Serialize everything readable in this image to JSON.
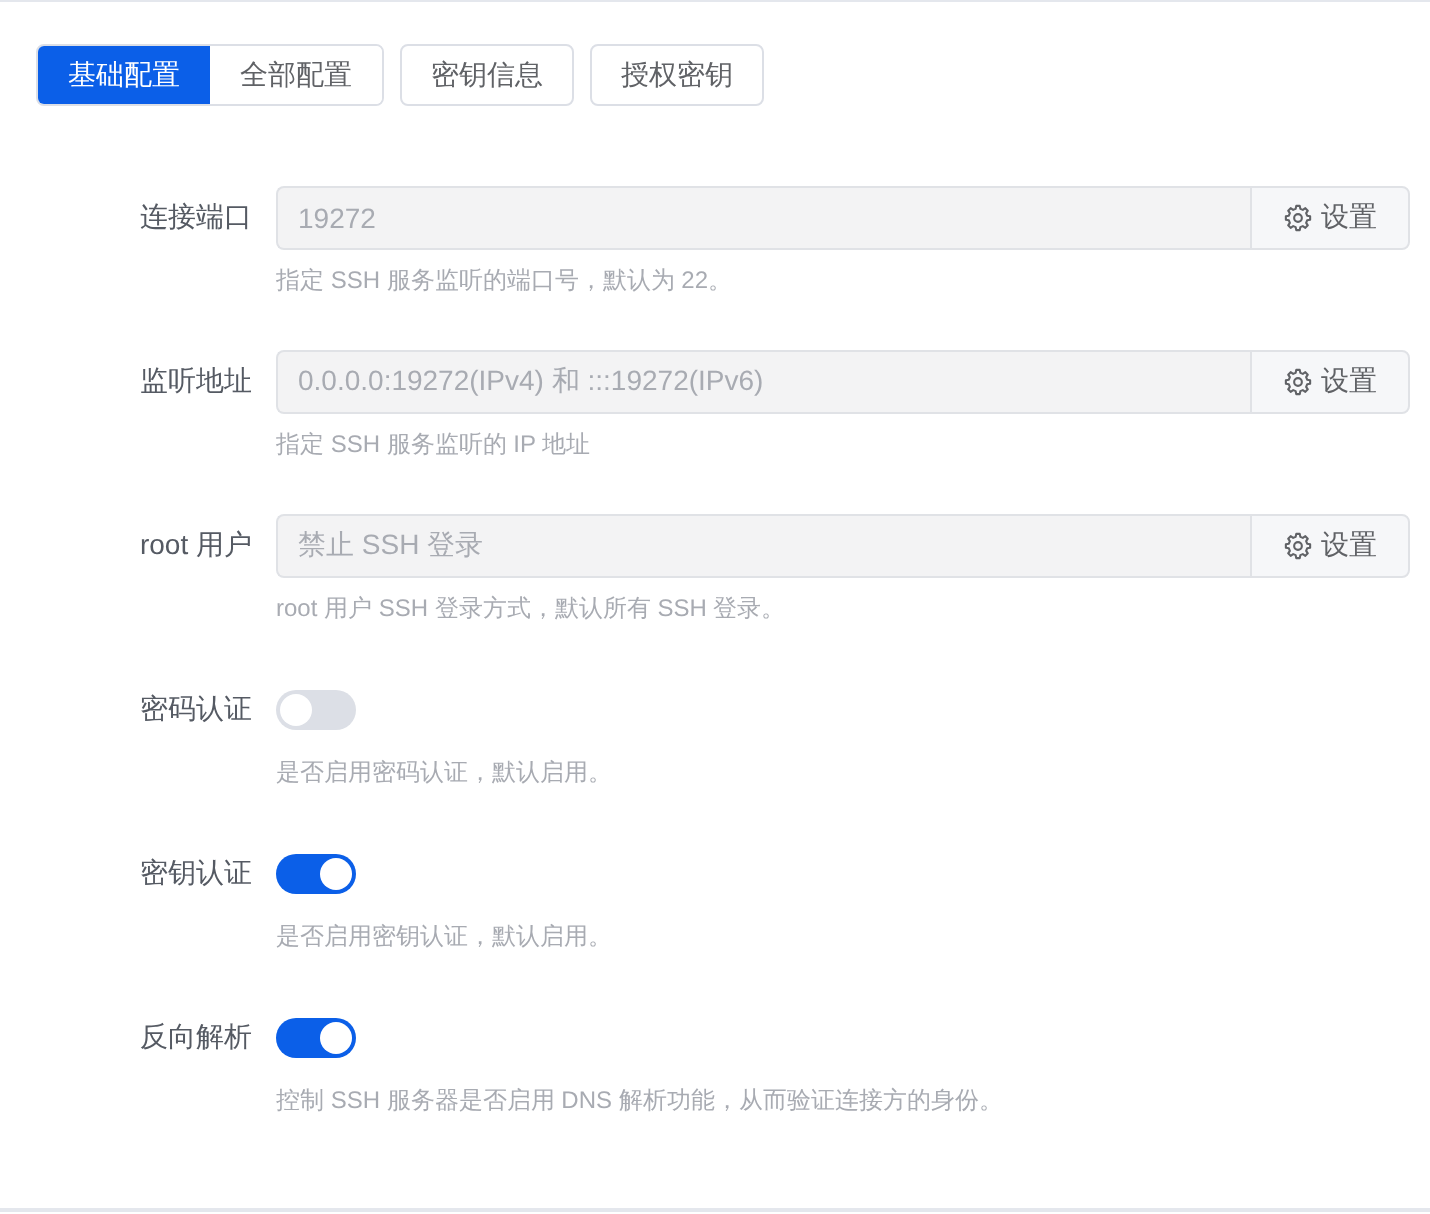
{
  "view_switch": [
    {
      "label": "基础配置",
      "selected": true
    },
    {
      "label": "全部配置",
      "selected": false
    }
  ],
  "buttons": [
    "密钥信息",
    "授权密钥"
  ],
  "settings": [
    {
      "kind": "input",
      "label": "连接端口",
      "value": "19272",
      "disabled": true,
      "button": "设置",
      "help": "指定 SSH 服务监听的端口号，默认为 22。"
    },
    {
      "kind": "input",
      "label": "监听地址",
      "value": "0.0.0.0:19272(IPv4) 和 :::19272(IPv6)",
      "disabled": true,
      "button": "设置",
      "help": "指定 SSH 服务监听的 IP 地址"
    },
    {
      "kind": "input",
      "label": "root 用户",
      "value": "禁止 SSH 登录",
      "disabled": true,
      "button": "设置",
      "help": "root 用户 SSH 登录方式，默认所有 SSH 登录。"
    },
    {
      "kind": "switch",
      "label": "密码认证",
      "on": false,
      "help": "是否启用密码认证，默认启用。"
    },
    {
      "kind": "switch",
      "label": "密钥认证",
      "on": true,
      "help": "是否启用密钥认证，默认启用。"
    },
    {
      "kind": "switch",
      "label": "反向解析",
      "on": true,
      "help": "控制 SSH 服务器是否启用 DNS 解析功能，从而验证连接方的身份。"
    }
  ]
}
